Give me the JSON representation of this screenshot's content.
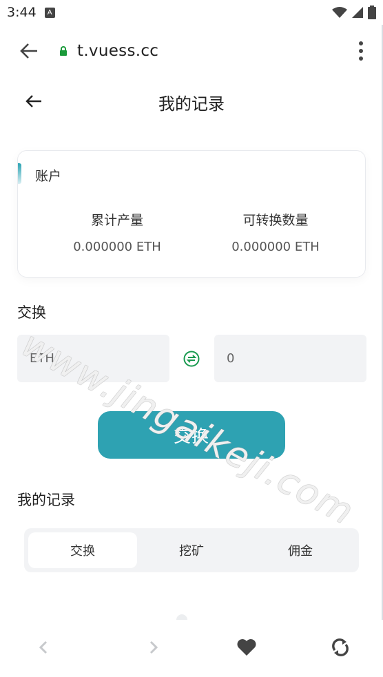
{
  "status_bar": {
    "time": "3:44",
    "notif_icon": "A"
  },
  "browser": {
    "url": "t.vuess.cc"
  },
  "page": {
    "title": "我的记录"
  },
  "account": {
    "label": "账户",
    "stats": [
      {
        "label": "累计产量",
        "value": "0.000000 ETH"
      },
      {
        "label": "可转换数量",
        "value": "0.000000 ETH"
      }
    ]
  },
  "exchange": {
    "title": "交换",
    "from_value": "ETH",
    "to_value": "0",
    "button_label": "交换",
    "accent_color": "#2ea2b2",
    "swap_color": "#1a9a50"
  },
  "records": {
    "title": "我的记录",
    "tabs": [
      {
        "label": "交换",
        "active": true
      },
      {
        "label": "挖矿",
        "active": false
      },
      {
        "label": "佣金",
        "active": false
      }
    ]
  },
  "watermark": {
    "text": "www.jingaikeji.com"
  }
}
